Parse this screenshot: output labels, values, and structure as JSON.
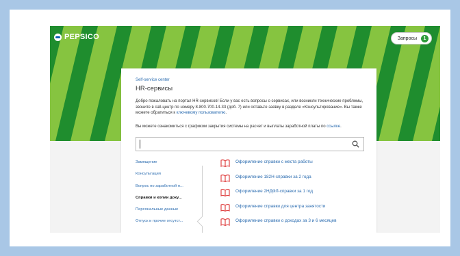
{
  "colors": {
    "hero_green": "#1f8d2e",
    "stripe_lime": "#86c440",
    "link": "#2b6cb0",
    "badge": "#2d9b3a",
    "book_icon": "#e04545"
  },
  "header": {
    "logo_text": "PEPSICO",
    "requests_label": "Запросы",
    "requests_count": "1"
  },
  "card": {
    "breadcrumb": "Self-service center",
    "title": "HR-сервисы",
    "intro_text": "Добро пожаловать на портал HR-сервисов! Если у вас есть вопросы о сервисах, или возникли технические проблемы, звоните в call-центр по номеру 8-800-700-14-33 (доб. 7) или оставьте заявку в разделе «Консультирование». Вы также можете обратиться к",
    "intro_link": "ключевому пользователю",
    "intro_end": ".",
    "schedule_text": "Вы можете ознакомиться с графиком закрытия системы на расчет и выплаты заработной платы по",
    "schedule_link": "ссылке",
    "schedule_end": "."
  },
  "search": {
    "icon": "search-icon"
  },
  "categories": [
    {
      "label": "Замещение"
    },
    {
      "label": "Консультация"
    },
    {
      "label": "Вопрос по заработной п..."
    },
    {
      "label": "Справки и копии доку...",
      "active": true
    },
    {
      "label": "Персональные данные"
    },
    {
      "label": "Отпуск и прочие отсутст..."
    }
  ],
  "documents": [
    {
      "label": "Оформление справки с места работы",
      "icon": "book-icon"
    },
    {
      "label": "Оформление 182Н-справки за 2 года",
      "icon": "book-icon"
    },
    {
      "label": "Оформление 2НДФЛ-справки за 1 год",
      "icon": "book-icon"
    },
    {
      "label": "Оформление справки для центра занятости",
      "icon": "book-icon"
    },
    {
      "label": "Оформление справки о доходах за 3 и 6 месяцев",
      "icon": "book-icon"
    }
  ]
}
